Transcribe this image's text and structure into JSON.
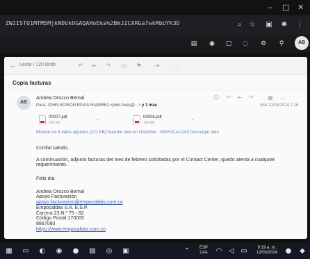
{
  "window": {
    "minimize": "–",
    "maximize": "□",
    "close": "✕"
  },
  "browser": {
    "url": "ZW2ISTQ1MTM5MjkNDUkOGAQAHoEka%2BmJZCARGa7wkMbUYK3D",
    "icons": [
      "zoom-icon",
      "star-icon",
      "reader-icon",
      "extensions-icon",
      "menu-icon"
    ]
  },
  "toolbar2": {
    "avatar_initials": "AB"
  },
  "mail_toolbar": {
    "status": "Leído / 120 leído"
  },
  "message": {
    "subject": "Copia facturas",
    "sender_initials": "AB",
    "sender_name": "Andrea Orozco Bernal",
    "to_prefix": "Para:",
    "to_value": "JOHN EDISON RIVAS RAMIREZ <john.rivas@...>",
    "to_more": "y 1 más",
    "date": "Mar 12/03/2024 7:16",
    "attachments": [
      {
        "name": "00007.pdf",
        "size": "100 KB"
      },
      {
        "name": "00006.pdf",
        "size": "100 KB"
      }
    ],
    "actions": "Mostrar los 8 datos adjuntos (221 KB)   Guardar todo en OneDrive - EMPOCALDAS   Descargar todo",
    "greeting": "Cordial saludo,",
    "paragraph": "A continuación, adjunto facturas del mes de febrero solicitadas por el Contact Center, quedo atenta a cualquier requerimiento.",
    "closing": "Feliz día",
    "signature": {
      "name": "Andrea Orozco Bernal",
      "role": "Apoyo Facturación",
      "email": "apoyo.facturacion@empocaldas.com.co",
      "company": "Empocaldas S.A. E.S.P.",
      "address": "Carrera 23 N.º 75 - 82",
      "postal": "Código Postal 170005",
      "phone": "8867080",
      "web": "https://www.empocaldas.com.co"
    }
  },
  "taskbar": {
    "lang": "ESP",
    "lang_sub": "LAA",
    "time": "9:19 a. m.",
    "date": "12/03/2024"
  }
}
